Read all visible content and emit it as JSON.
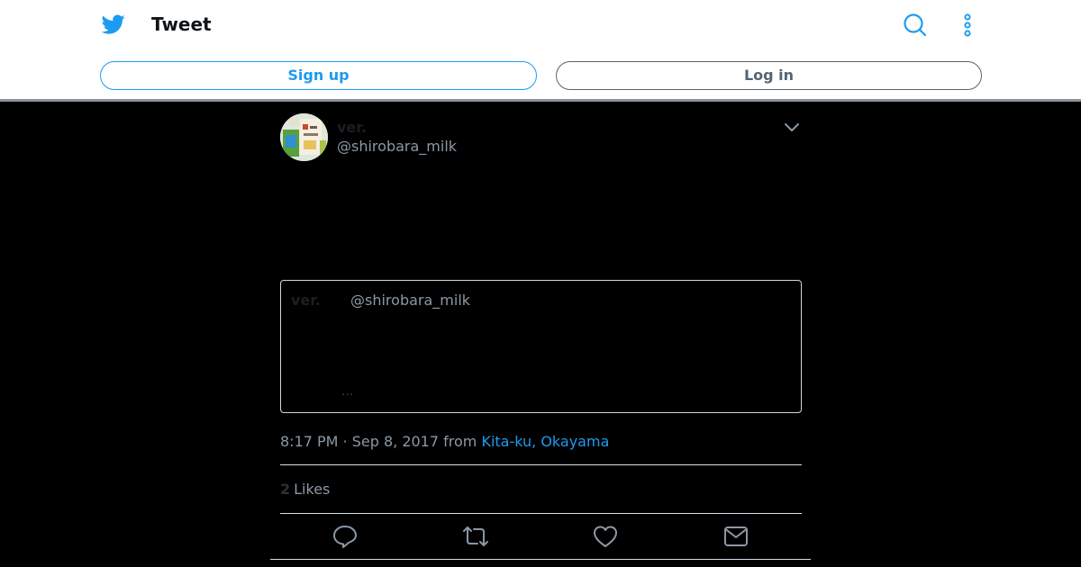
{
  "header": {
    "title": "Tweet",
    "signup_label": "Sign up",
    "login_label": "Log in",
    "brand_color": "#1d9bf0"
  },
  "tweet": {
    "display_name": "ver.",
    "handle": "@shirobara_milk",
    "quoted": {
      "display_name": "ver.",
      "handle": "@shirobara_milk",
      "truncation": "..."
    },
    "timestamp": "8:17 PM · Sep 8, 2017 from ",
    "location": "Kita-ku, Okayama",
    "likes_count": "2",
    "likes_label": "Likes"
  },
  "icons": [
    "twitter-bird-icon",
    "search-icon",
    "more-vertical-icon",
    "chevron-down-icon",
    "reply-icon",
    "retweet-icon",
    "like-icon",
    "share-mail-icon"
  ]
}
